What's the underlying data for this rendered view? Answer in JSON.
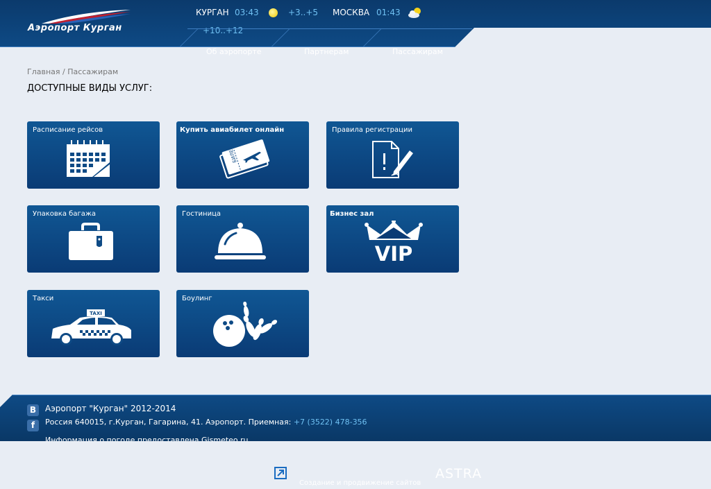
{
  "header": {
    "logo_text": "Аэропорт Курган",
    "weather": [
      {
        "city": "КУРГАН",
        "time": "03:43",
        "temp": "+3..+5",
        "icon": "sun-icon"
      },
      {
        "city": "МОСКВА",
        "time": "01:43",
        "temp": "+10..+12",
        "icon": "cloud-sun-icon"
      }
    ],
    "nav": [
      "Об аэропорте",
      "Партнерам",
      "Пассажирам"
    ]
  },
  "breadcrumb": "Главная / Пассажирам",
  "page_title": "ДОСТУПНЫЕ ВИДЫ УСЛУГ:",
  "tiles": [
    {
      "label": "Расписание рейсов",
      "icon": "calendar-icon"
    },
    {
      "label": "Купить авиабилет онлайн",
      "icon": "ticket-icon"
    },
    {
      "label": "Правила регистрации",
      "icon": "document-pen-icon"
    },
    {
      "label": "Упаковка багажа",
      "icon": "suitcase-icon"
    },
    {
      "label": "Гостиница",
      "icon": "cloche-icon"
    },
    {
      "label": "Бизнес зал",
      "icon": "vip-crown-icon"
    },
    {
      "label": "Такси",
      "icon": "taxi-icon"
    },
    {
      "label": "Боулинг",
      "icon": "bowling-icon"
    }
  ],
  "ticket_text": "БИЛЕТ",
  "taxi_sign": "TAXI",
  "vip_text": "VIP",
  "footer": {
    "copyright": "Аэропорт \"Курган\" 2012-2014",
    "address": "Россия 640015, г.Курган, Гагарина, 41. Аэропорт. Приемная: ",
    "phone": "+7 (3522) 478-356",
    "weather_credit": "Информация о погоде предоставлена Gismeteo.ru",
    "social_vk": "B",
    "social_fb": "f",
    "studio_text": "Создание и продвижение сайтов",
    "studio_brand": "ASTRA"
  },
  "colors": {
    "accent": "#6fc0f2",
    "tile_top": "#105794",
    "tile_bottom": "#0a3b75",
    "header": "#0b3a6c"
  }
}
